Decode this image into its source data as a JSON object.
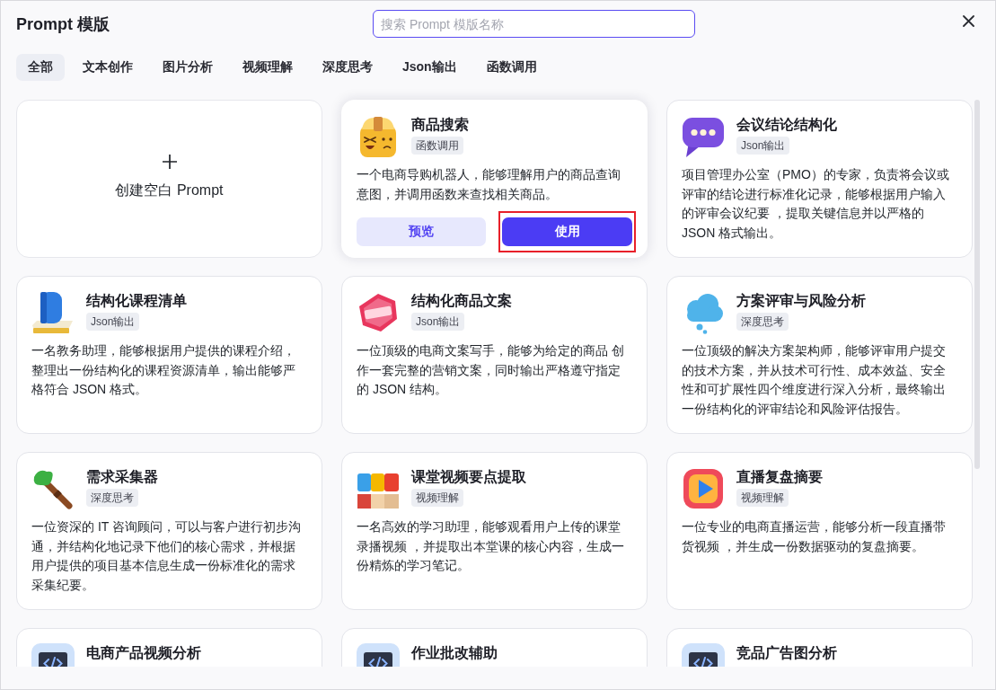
{
  "header": {
    "title": "Prompt 模版",
    "search": {
      "placeholder": "搜索 Prompt 模版名称",
      "focused": true
    }
  },
  "tabs": [
    {
      "label": "全部",
      "selected": true
    },
    {
      "label": "文本创作",
      "selected": false
    },
    {
      "label": "图片分析",
      "selected": false
    },
    {
      "label": "视频理解",
      "selected": false
    },
    {
      "label": "深度思考",
      "selected": false
    },
    {
      "label": "Json输出",
      "selected": false
    },
    {
      "label": "函数调用",
      "selected": false
    }
  ],
  "create_card": {
    "label": "创建空白 Prompt"
  },
  "cards": [
    {
      "title": "商品搜索",
      "tag": "函数调用",
      "description": "一个电商导购机器人，能够理解用户的商品查询意图，并调用函数来查找相关商品。",
      "hovered": true,
      "buttons": [
        {
          "label": "预览",
          "kind": "secondary",
          "highlighted": false
        },
        {
          "label": "使用",
          "kind": "primary",
          "highlighted": true
        }
      ]
    },
    {
      "title": "会议结论结构化",
      "tag": "Json输出",
      "description": "项目管理办公室（PMO）的专家，负责将会议或评审的结论进行标准化记录，能够根据用户输入的评审会议纪要 ，提取关键信息并以严格的 JSON 格式输出。",
      "hovered": false
    },
    {
      "title": "结构化课程清单",
      "tag": "Json输出",
      "description": "一名教务助理，能够根据用户提供的课程介绍，整理出一份结构化的课程资源清单，输出能够严格符合 JSON 格式。",
      "hovered": false
    },
    {
      "title": "结构化商品文案",
      "tag": "Json输出",
      "description": "一位顶级的电商文案写手，能够为给定的商品 创作一套完整的营销文案，同时输出严格遵守指定的 JSON 结构。",
      "hovered": false
    },
    {
      "title": "方案评审与风险分析",
      "tag": "深度思考",
      "description": "一位顶级的解决方案架构师，能够评审用户提交的技术方案，并从技术可行性、成本效益、安全性和可扩展性四个维度进行深入分析，最终输出一份结构化的评审结论和风险评估报告。",
      "hovered": false
    },
    {
      "title": "需求采集器",
      "tag": "深度思考",
      "description": "一位资深的 IT 咨询顾问，可以与客户进行初步沟通，并结构化地记录下他们的核心需求，并根据用户提供的项目基本信息生成一份标准化的需求采集纪要。",
      "hovered": false
    },
    {
      "title": "课堂视频要点提取",
      "tag": "视频理解",
      "description": "一名高效的学习助理，能够观看用户上传的课堂录播视频 ，并提取出本堂课的核心内容，生成一份精炼的学习笔记。",
      "hovered": false
    },
    {
      "title": "直播复盘摘要",
      "tag": "视频理解",
      "description": "一位专业的电商直播运营，能够分析一段直播带货视频 ，并生成一份数据驱动的复盘摘要。",
      "hovered": false
    },
    {
      "title": "电商产品视频分析",
      "hovered": false
    },
    {
      "title": "作业批改辅助",
      "hovered": false
    },
    {
      "title": "竞品广告图分析",
      "hovered": false
    }
  ]
}
